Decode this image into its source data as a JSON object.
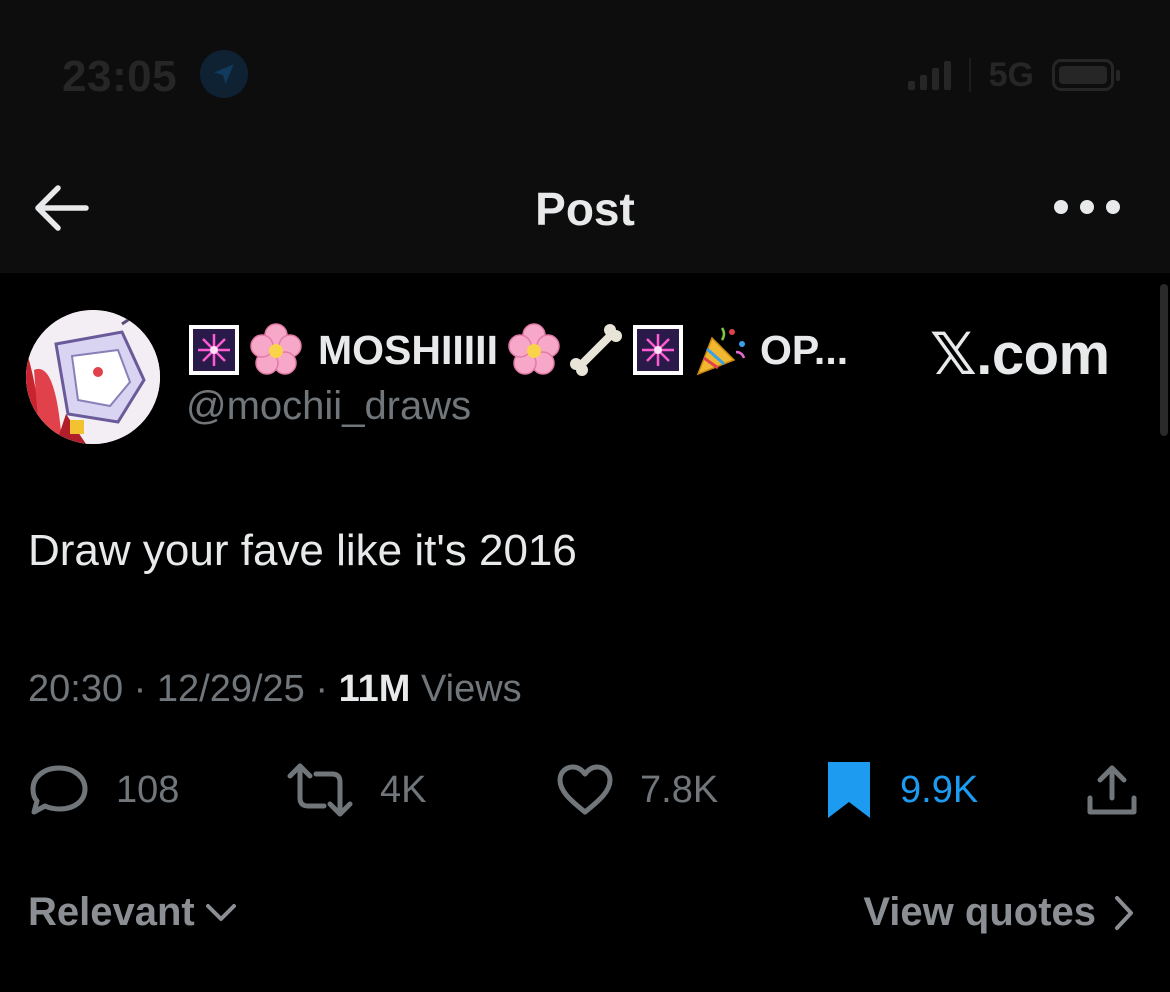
{
  "status_bar": {
    "time": "23:05",
    "network": "5G"
  },
  "header": {
    "title": "Post"
  },
  "post": {
    "author": {
      "name_start": "MOSHIIIII",
      "name_end": "OP...",
      "handle": "@mochii_draws"
    },
    "source_badge": "𝕏.com",
    "text": "Draw your fave like it's 2016",
    "time": "20:30",
    "date": "12/29/25",
    "views_count": "11M",
    "views_label": "Views",
    "separator": "·"
  },
  "actions": {
    "replies": "108",
    "reposts": "4K",
    "likes": "7.8K",
    "bookmarks": "9.9K"
  },
  "footer": {
    "sort_label": "Relevant",
    "quotes_label": "View quotes"
  },
  "colors": {
    "accent": "#1d9bf0",
    "muted": "#71767b",
    "text": "#e7e9ea",
    "background": "#000000"
  },
  "icons": [
    "location-arrow-icon",
    "signal-icon",
    "battery-icon",
    "back-arrow-icon",
    "more-icon",
    "fireworks-emoji-icon",
    "cherry-blossom-emoji-icon",
    "bone-emoji-icon",
    "party-popper-emoji-icon",
    "reply-icon",
    "repost-icon",
    "like-icon",
    "bookmark-icon",
    "share-icon",
    "chevron-down-icon",
    "chevron-right-icon"
  ]
}
